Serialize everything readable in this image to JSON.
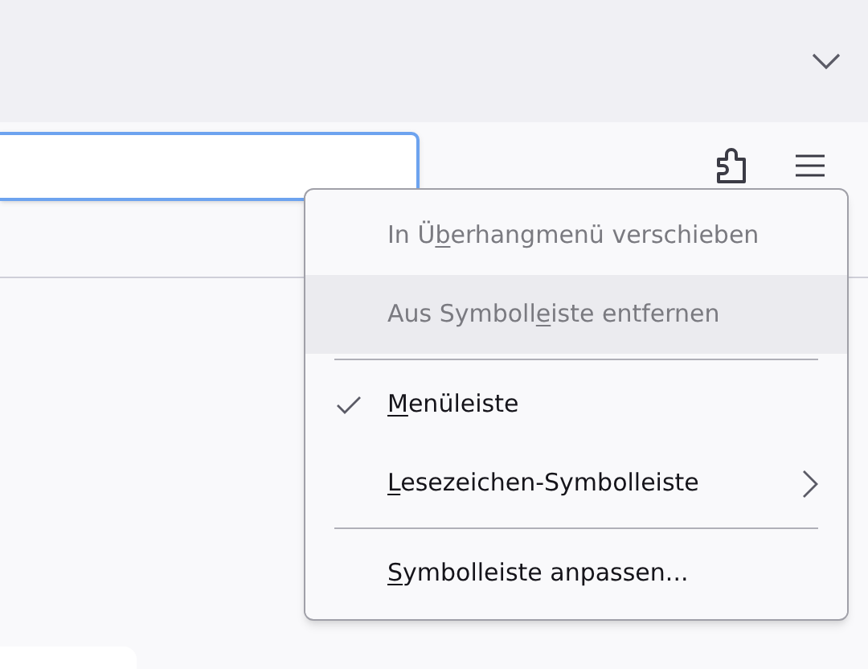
{
  "menu": {
    "items": [
      {
        "kind": "item",
        "label_before": "In Ü",
        "access_key": "b",
        "label_after": "erhangmenü verschieben",
        "disabled": true,
        "selected": false,
        "checked": false,
        "submenu": false
      },
      {
        "kind": "item",
        "label_before": "Aus Symboll",
        "access_key": "e",
        "label_after": "iste entfernen",
        "disabled": true,
        "selected": true,
        "checked": false,
        "submenu": false
      },
      {
        "kind": "separator"
      },
      {
        "kind": "item",
        "access_key": "M",
        "label_after": "enüleiste",
        "disabled": false,
        "selected": false,
        "checked": true,
        "submenu": false
      },
      {
        "kind": "item",
        "access_key": "L",
        "label_after": "esezeichen-Symbolleiste",
        "disabled": false,
        "selected": false,
        "checked": false,
        "submenu": true
      },
      {
        "kind": "separator"
      },
      {
        "kind": "item",
        "access_key": "S",
        "label_after": "ymbolleiste anpassen...",
        "disabled": false,
        "selected": false,
        "checked": false,
        "submenu": false
      }
    ]
  }
}
